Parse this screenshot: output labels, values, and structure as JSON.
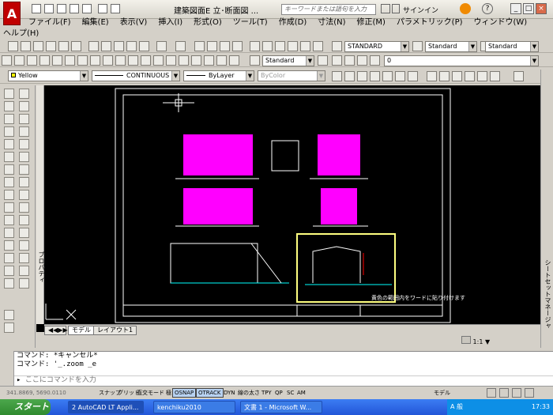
{
  "window": {
    "title": "建築図面E 立･断面図 ...",
    "search_placeholder": "キーワードまたは語句を入力",
    "signin": "サインイン"
  },
  "menu": [
    "ファイル(F)",
    "編集(E)",
    "表示(V)",
    "挿入(I)",
    "形式(O)",
    "ツール(T)",
    "作成(D)",
    "寸法(N)",
    "修正(M)",
    "パラメトリック(P)",
    "ウィンドウ(W)",
    "ヘルプ(H)"
  ],
  "toolbars": {
    "text_style": "STANDARD",
    "dim_style": "Standard",
    "table_style": "Standard",
    "workspace_style": "Standard",
    "layer": "0",
    "color": "Yellow",
    "linetype": "CONTINUOUS",
    "lineweight": "ByLayer",
    "plotstyle": "ByColor"
  },
  "drawing": {
    "annotation": "黄色の範囲内をワードに貼り付けます",
    "highlight_color": "#ffff80"
  },
  "panels": {
    "properties": "プロパティ",
    "sheet_set": "シートセットマネージャ"
  },
  "tabs": [
    "モデル",
    "レイアウト1"
  ],
  "scale": "1:1",
  "command_lines": [
    "コマンド: *キャンセル*",
    "コマンド: '_.zoom _e"
  ],
  "command_prompt": "ここにコマンドを入力",
  "status": {
    "coords": "341.8869, 5690.0110",
    "toggles": [
      {
        "label": "スナップ",
        "on": false
      },
      {
        "label": "グリッド",
        "on": false
      },
      {
        "label": "直交モード",
        "on": false
      },
      {
        "label": "極",
        "on": false
      },
      {
        "label": "OSNAP",
        "on": true
      },
      {
        "label": "OTRACK",
        "on": true
      },
      {
        "label": "DYN",
        "on": false
      },
      {
        "label": "線の太さ",
        "on": false
      },
      {
        "label": "TPY",
        "on": false
      },
      {
        "label": "QP",
        "on": false
      },
      {
        "label": "SC",
        "on": false
      },
      {
        "label": "AM",
        "on": false
      }
    ],
    "model": "モデル"
  },
  "taskbar": {
    "start": "スタート",
    "tasks": [
      "2 AutoCAD LT Appli...",
      "kenchiku2010",
      "文書 1 - Microsoft W..."
    ],
    "ime": "A 般",
    "clock": "17:33"
  }
}
